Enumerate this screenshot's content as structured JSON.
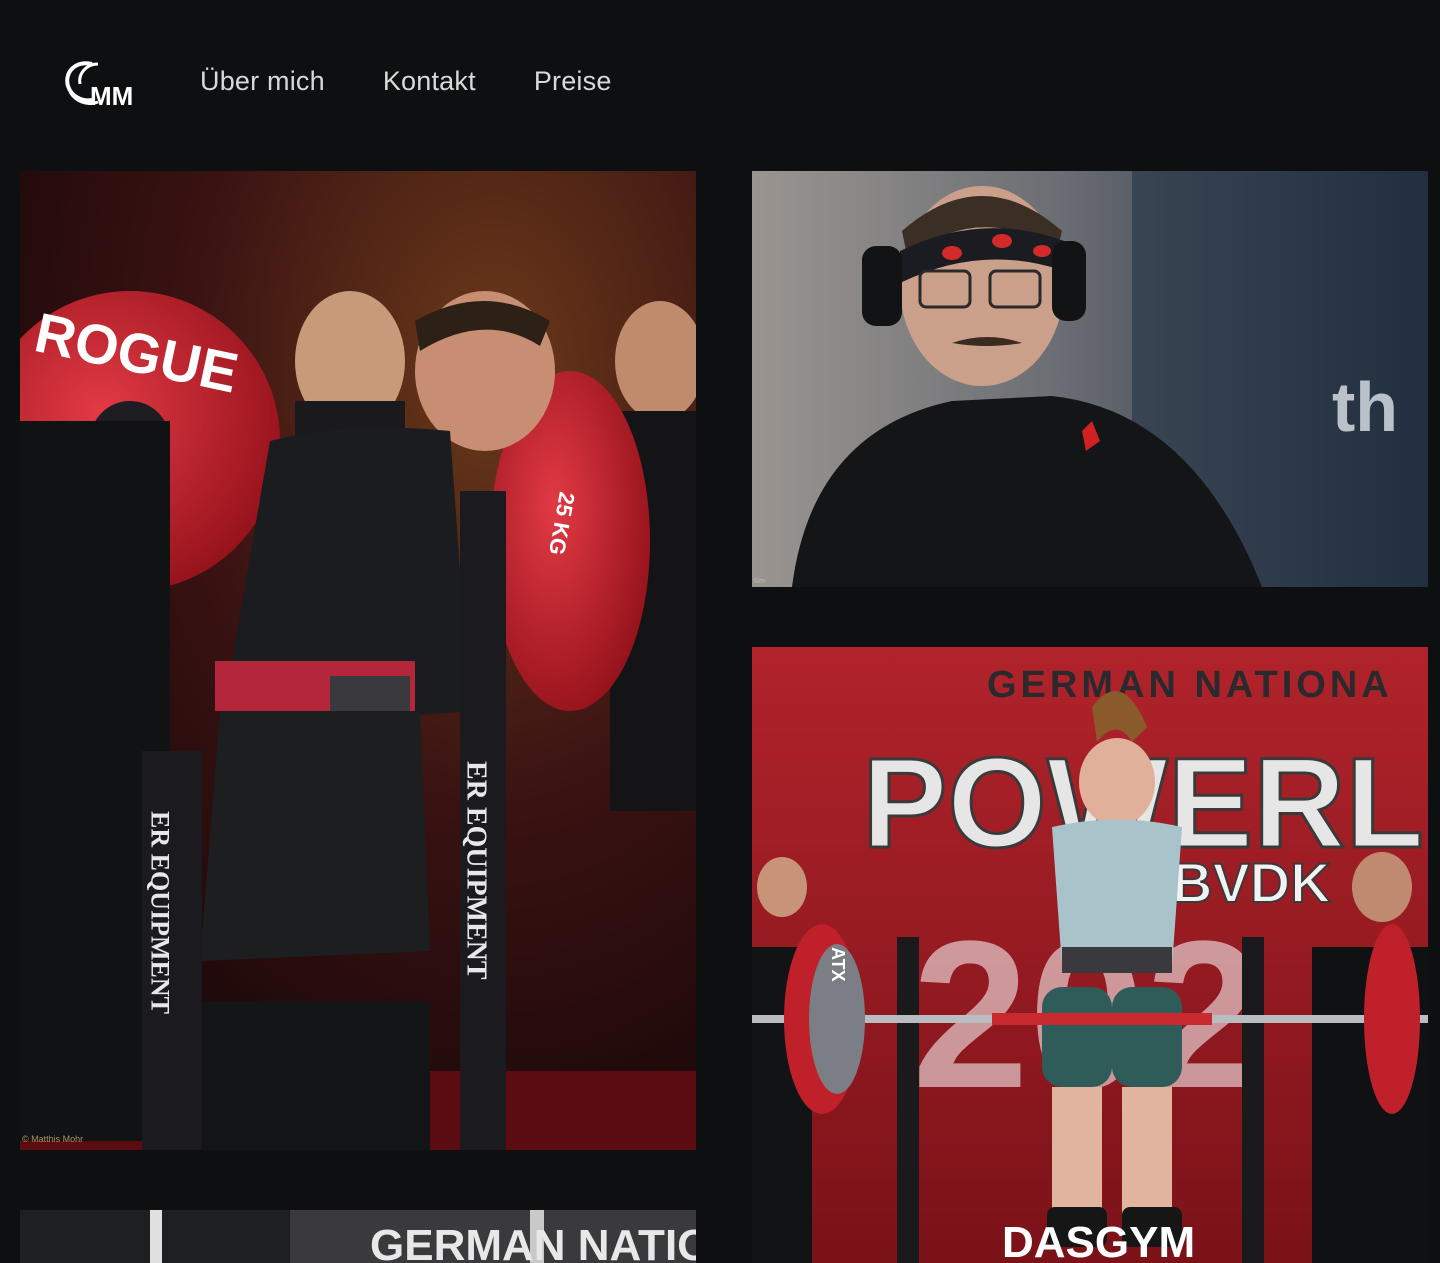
{
  "header": {
    "logo_text": "MM",
    "nav": [
      {
        "label": "Über mich"
      },
      {
        "label": "Kontakt"
      },
      {
        "label": "Preise"
      }
    ]
  },
  "gallery": {
    "photo1": {
      "plate_brand": "ROGUE",
      "plate_weight": "25 KG",
      "rack_text": "ER EQUIPMENT",
      "credit": "© Matthis Mohr"
    },
    "photo2": {
      "credit": "©m"
    },
    "photo3": {
      "banner_top": "GERMAN NATIONA",
      "banner_mid": "POWERLIFT",
      "banner_sub": "BVDK",
      "banner_year": "202",
      "sponsor": "DASGYM",
      "plate_brand": "ATX"
    },
    "photo4": {
      "banner_top": "GERMAN NATIONA"
    }
  },
  "colors": {
    "background": "#0e0f11",
    "nav_text": "#d9d9d9",
    "accent_red": "#c3232b"
  }
}
